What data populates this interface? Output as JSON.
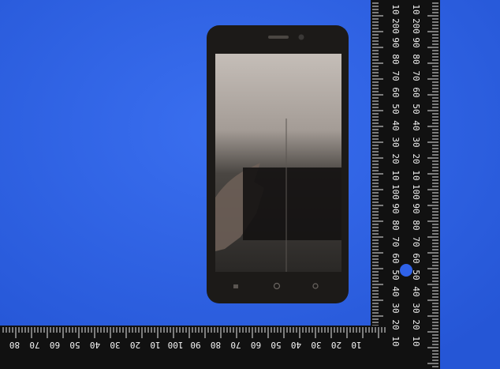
{
  "photo": {
    "background_color": "#2f62e8",
    "phone": {
      "body_color": "#1c1a18",
      "screen_top_color": "#b8b1ab",
      "screen_bottom_color": "#2c2a28",
      "nav_icons": [
        "circle-icon",
        "circle-icon"
      ]
    },
    "ruler_vertical": {
      "color": "#111111",
      "labels": [
        "10",
        "200",
        "90",
        "80",
        "70",
        "60",
        "50",
        "40",
        "30",
        "20",
        "10",
        "100",
        "90",
        "80",
        "70",
        "60",
        "50",
        "40",
        "30",
        "20",
        "10"
      ]
    },
    "ruler_horizontal": {
      "color": "#111111",
      "labels": [
        "10",
        "20",
        "30",
        "40",
        "50",
        "60",
        "70",
        "80",
        "90",
        "100",
        "10",
        "20",
        "30",
        "40",
        "50",
        "60",
        "70",
        "80"
      ]
    }
  }
}
